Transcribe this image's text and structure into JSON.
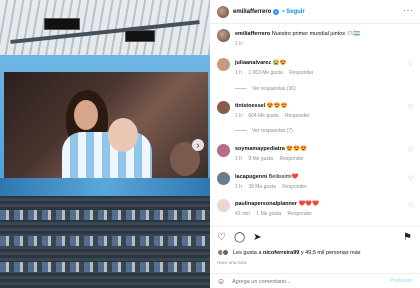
{
  "post": {
    "author": "emiliafferrero",
    "follow_label": "Seguir",
    "caption_user": "emiliafferrero",
    "caption_text": "Nuestro primer mundial juntos 🫶🏻🇦🇷",
    "caption_time": "1 h"
  },
  "comments": [
    {
      "user": "juliaanalvarez",
      "text": "😭😍",
      "time": "1 h",
      "likes": "1.063 Me gusta",
      "reply": "Responder",
      "avatar_color": "#c89b7b"
    },
    {
      "user": "tinistoessel",
      "text": "😍😍😍",
      "time": "1 h",
      "likes": "664 Me gusta",
      "reply": "Responder",
      "avatar_color": "#8a5b4a"
    },
    {
      "user": "soymamaypediatra",
      "text": "😍😍😍",
      "time": "1 h",
      "likes": "9 Me gusta",
      "reply": "Responder",
      "avatar_color": "#b86a8c"
    },
    {
      "user": "lacapugenni",
      "text": "Bellissimi❤️",
      "time": "1 h",
      "likes": "38 Me gusta",
      "reply": "Responder",
      "avatar_color": "#6b7d8c"
    },
    {
      "user": "paulinapersonalplanner",
      "text": "❤️❤️❤️",
      "time": "43 min",
      "likes": "1 Me gusta",
      "reply": "Responder",
      "avatar_color": "#e8d6cf"
    }
  ],
  "replies": [
    {
      "label": "Ver respuestas (36)"
    },
    {
      "label": "Ver respuestas (7)"
    }
  ],
  "actions": {
    "like_icon": "heart-icon",
    "comment_icon": "comment-icon",
    "share_icon": "send-icon",
    "save_icon": "bookmark-icon"
  },
  "likes_summary": {
    "prefix": "Les gusta a ",
    "user": "nicoferreira99",
    "suffix": " y 49,5 mil personas más"
  },
  "post_date": "Hace una hora",
  "comment_box": {
    "placeholder": "Agrega un comentario...",
    "publish_label": "Publicar"
  },
  "colors": {
    "accent": "#0095f6",
    "verified": "#3897f0",
    "muted": "#8e8e8e"
  }
}
